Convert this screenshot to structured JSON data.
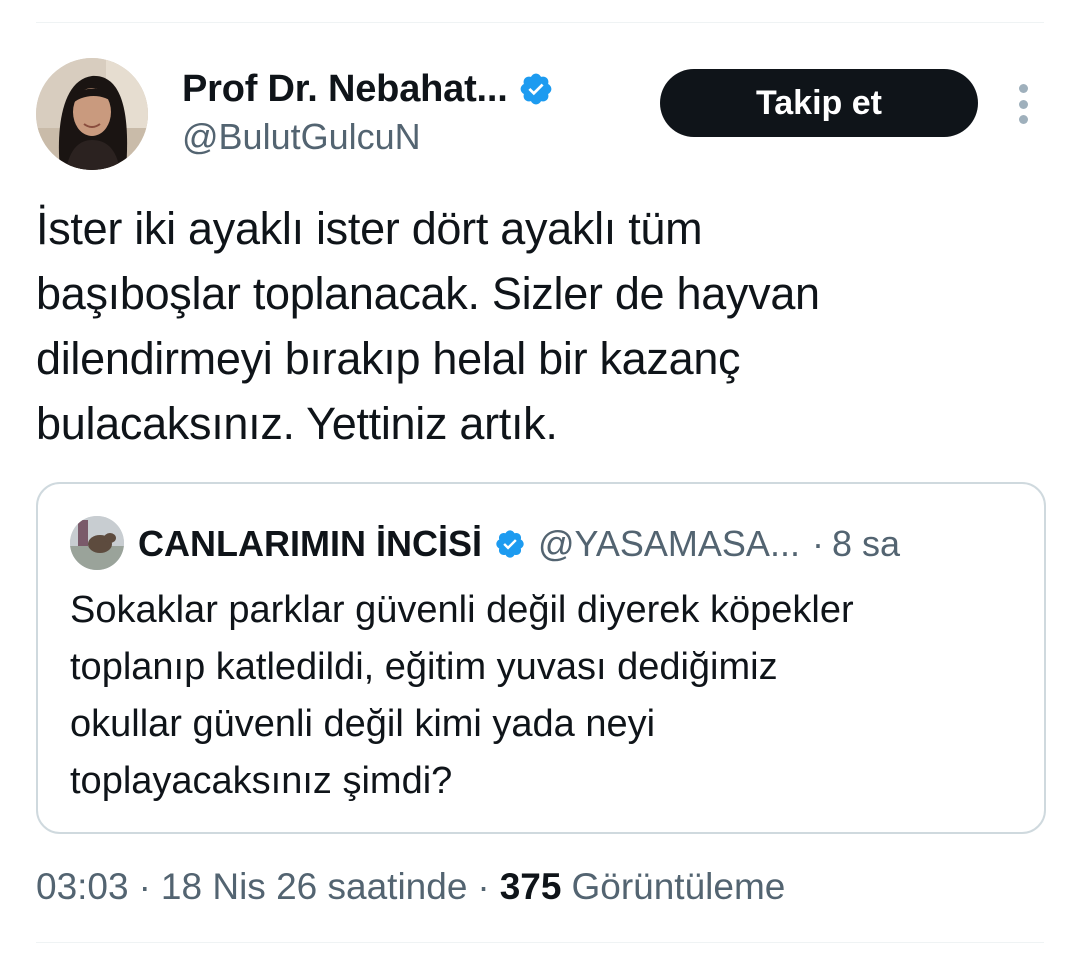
{
  "author": {
    "display_name": "Prof Dr. Nebahat...",
    "handle": "@BulutGulcuN",
    "verified_icon": "verified-badge-icon",
    "verified_color": "#1d9bf0"
  },
  "follow_button_label": "Takip et",
  "more_icon": "more-vertical-icon",
  "tweet_text_lines": [
    "İster iki ayaklı ister dört ayaklı tüm",
    "başıboşlar toplanacak. Sizler de hayvan",
    "dilendirmeyi bırakıp helal bir kazanç",
    "bulacaksınız. Yettiniz artık."
  ],
  "quoted_tweet": {
    "display_name": "CANLARIMIN İNCİSİ",
    "handle": "@YASAMASA...",
    "separator": "·",
    "time_ago": "8 sa",
    "text_lines": [
      "Sokaklar parklar güvenli değil diyerek köpekler",
      "toplanıp katledildi, eğitim yuvası dediğimiz",
      "okullar güvenli değil kimi yada neyi",
      "toplayacaksınız şimdi?"
    ]
  },
  "meta": {
    "time": "03:03",
    "separator": "·",
    "date": "18 Nis 26 saatinde",
    "views_count": "375",
    "views_label": "Görüntüleme"
  },
  "colors": {
    "text_primary": "#0f1419",
    "text_secondary": "#536471",
    "border": "#cfd9de",
    "button_bg": "#0f1419",
    "button_text": "#ffffff"
  }
}
